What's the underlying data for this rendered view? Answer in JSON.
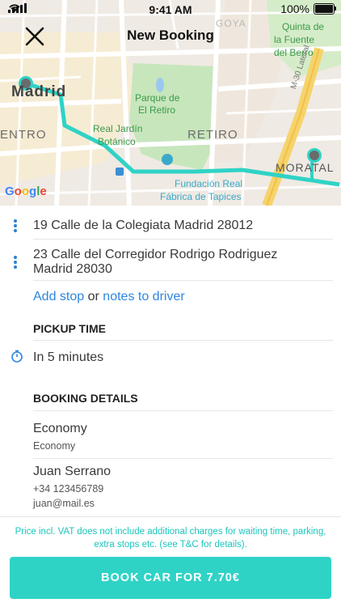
{
  "status_bar": {
    "time": "9:41 AM",
    "battery": "100%",
    "battery_level": 1.0
  },
  "header": {
    "title": "New Booking"
  },
  "map": {
    "labels": {
      "madrid": "Madrid",
      "centro": "ENTRO",
      "goya": "GOYA",
      "quinta": "Quinta de",
      "fuente": "la Fuente",
      "berro": "del Berro",
      "parque_1": "Parque de",
      "parque_2": "El Retiro",
      "jardin_1": "Real Jardín",
      "jardin_2": "Botánico",
      "retiro": "RETIRO",
      "m30": "M-30 Lateral",
      "moratalaz": "MORATAL",
      "fundacion_1": "Fundación Real",
      "fundacion_2": "Fábrica de Tapices"
    },
    "route_color": "#2fd3c6"
  },
  "trip": {
    "pickup": "19 Calle de la Colegiata Madrid 28012",
    "dropoff_line1": "23 Calle del Corregidor Rodrigo Rodriguez",
    "dropoff_line2": "Madrid 28030",
    "add_stop": "Add stop",
    "or_text": "or",
    "notes_to_driver": "notes to driver"
  },
  "pickup_time": {
    "heading": "PICKUP TIME",
    "value": "In 5 minutes"
  },
  "booking_details": {
    "heading": "BOOKING DETAILS",
    "vehicle_title": "Economy",
    "vehicle_subtitle": "Economy",
    "passenger_name": "Juan Serrano",
    "passenger_phone": "+34 123456789",
    "passenger_email": "juan@mail.es"
  },
  "notice": "Price incl. VAT does not include additional charges for waiting time, parking, extra stops etc. (see T&C for details).",
  "book_button": "BOOK CAR FOR 7.70€",
  "colors": {
    "accent": "#2fd3c6",
    "link": "#2e86de",
    "notice": "#1bc5bd"
  }
}
